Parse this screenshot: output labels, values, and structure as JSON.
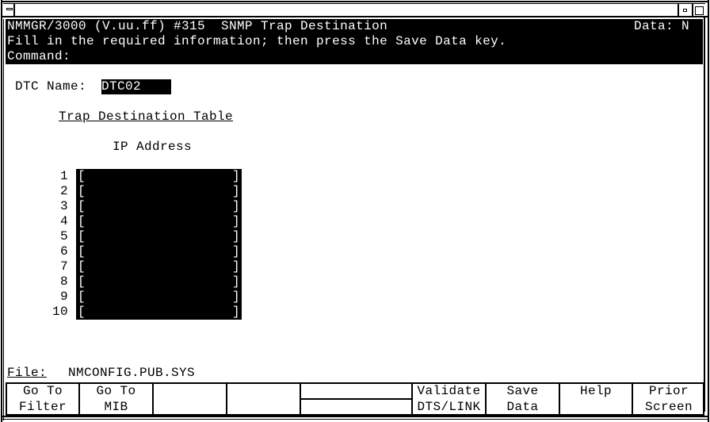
{
  "window": {
    "system_menu_icon": "system-menu-icon",
    "minimize_icon": "minimize-icon",
    "maximize_icon": "maximize-icon"
  },
  "header": {
    "title": "NMMGR/3000 (V.uu.ff) #315  SNMP Trap Destination",
    "data_flag": "Data: N",
    "message": "Fill in the required information; then press the Save Data key.",
    "command_label": "Command:",
    "command_value": ""
  },
  "form": {
    "dtc_name_label": "DTC Name:",
    "dtc_name_value": "DTC02",
    "table_title": "Trap Destination Table",
    "column_header": "IP Address",
    "rows": [
      {
        "num": "1",
        "ip": ""
      },
      {
        "num": "2",
        "ip": ""
      },
      {
        "num": "3",
        "ip": ""
      },
      {
        "num": "4",
        "ip": ""
      },
      {
        "num": "5",
        "ip": ""
      },
      {
        "num": "6",
        "ip": ""
      },
      {
        "num": "7",
        "ip": ""
      },
      {
        "num": "8",
        "ip": ""
      },
      {
        "num": "9",
        "ip": ""
      },
      {
        "num": "10",
        "ip": ""
      }
    ],
    "bracket_left": "[",
    "bracket_right": "]"
  },
  "footer": {
    "file_label": "File:",
    "file_value": "NMCONFIG.PUB.SYS"
  },
  "function_keys": [
    {
      "line1": "Go To",
      "line2": "Filter"
    },
    {
      "line1": "Go To",
      "line2": "MIB"
    },
    {
      "line1": "",
      "line2": ""
    },
    {
      "line1": "",
      "line2": ""
    },
    {
      "line1": "",
      "line2": ""
    },
    {
      "line1": "Validate",
      "line2": "DTS/LINK"
    },
    {
      "line1": "Save",
      "line2": "Data"
    },
    {
      "line1": "Help",
      "line2": ""
    },
    {
      "line1": "Prior",
      "line2": "Screen"
    }
  ]
}
